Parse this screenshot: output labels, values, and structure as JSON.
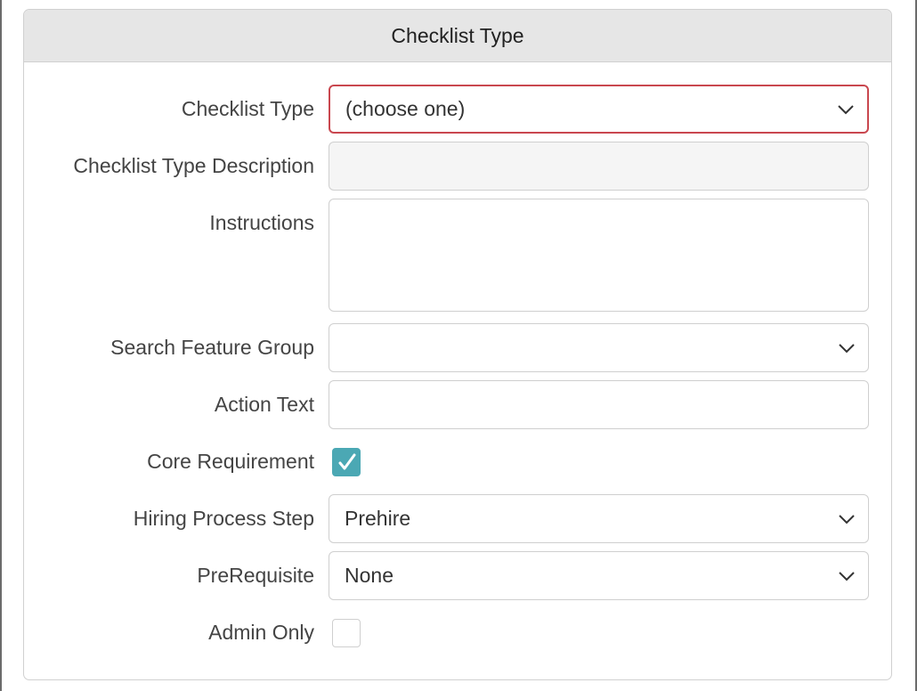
{
  "panel": {
    "title": "Checklist Type"
  },
  "form": {
    "checklist_type": {
      "label": "Checklist Type",
      "value": "(choose one)",
      "icon": "chevron-down-icon"
    },
    "checklist_type_description": {
      "label": "Checklist Type Description",
      "value": ""
    },
    "instructions": {
      "label": "Instructions",
      "value": ""
    },
    "search_feature_group": {
      "label": "Search Feature Group",
      "value": "",
      "icon": "chevron-down-icon"
    },
    "action_text": {
      "label": "Action Text",
      "value": ""
    },
    "core_requirement": {
      "label": "Core Requirement",
      "checked": true,
      "icon": "checkmark-icon"
    },
    "hiring_process_step": {
      "label": "Hiring Process Step",
      "value": "Prehire",
      "icon": "chevron-down-icon"
    },
    "prerequisite": {
      "label": "PreRequisite",
      "value": "None",
      "icon": "chevron-down-icon"
    },
    "admin_only": {
      "label": "Admin Only",
      "checked": false
    }
  },
  "colors": {
    "header_bg": "#e6e6e6",
    "invalid_border": "#c9474f",
    "checkbox_checked": "#4ba8b4",
    "readonly_bg": "#f5f5f5"
  }
}
